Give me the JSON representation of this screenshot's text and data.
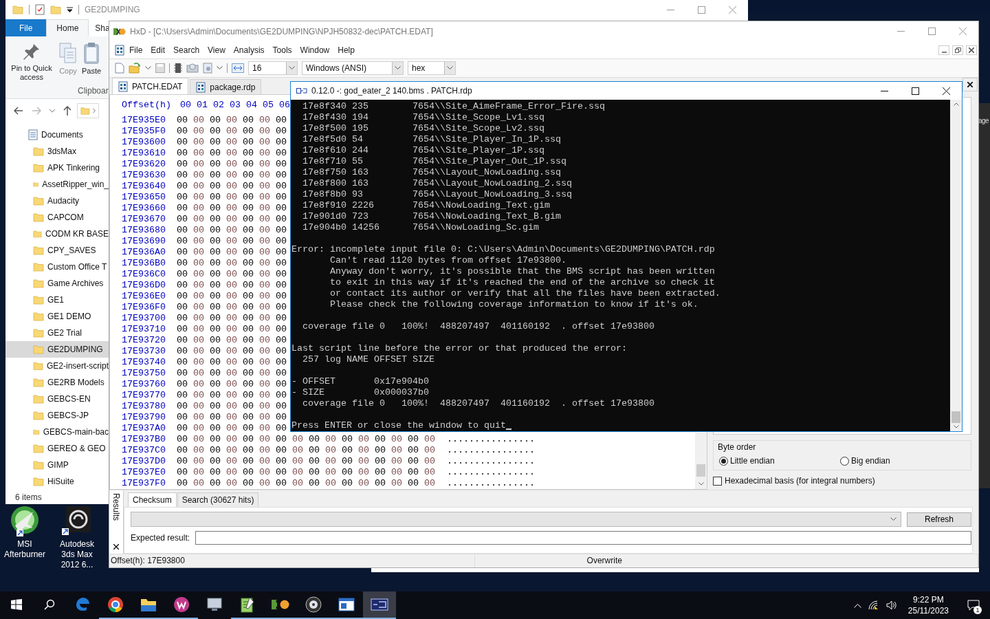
{
  "explorer": {
    "title": "GE2DUMPING",
    "ribbon_tabs": [
      {
        "label": "File",
        "kind": "file",
        "selected": false
      },
      {
        "label": "Home",
        "kind": "tab",
        "selected": true
      },
      {
        "label": "Sha",
        "kind": "tab",
        "selected": false
      }
    ],
    "ribbon_buttons": [
      {
        "label": "Pin to Quick access",
        "kind": "pin",
        "disabled": false
      },
      {
        "label": "Copy",
        "kind": "copy",
        "disabled": true
      },
      {
        "label": "Paste",
        "kind": "paste",
        "disabled": false
      }
    ],
    "ribbon_group": "Clipboar",
    "tree": [
      {
        "label": "Documents",
        "selected": false,
        "children": [
          {
            "label": "3dsMax",
            "selected": false
          },
          {
            "label": "APK Tinkering",
            "selected": false
          },
          {
            "label": "AssetRipper_win_",
            "selected": false
          },
          {
            "label": "Audacity",
            "selected": false
          },
          {
            "label": "CAPCOM",
            "selected": false
          },
          {
            "label": "CODM KR BASE",
            "selected": false
          },
          {
            "label": "CPY_SAVES",
            "selected": false
          },
          {
            "label": "Custom Office T",
            "selected": false
          },
          {
            "label": "Game Archives",
            "selected": false
          },
          {
            "label": "GE1",
            "selected": false
          },
          {
            "label": "GE1 DEMO",
            "selected": false
          },
          {
            "label": "GE2 Trial",
            "selected": false
          },
          {
            "label": "GE2DUMPING",
            "selected": true
          },
          {
            "label": "GE2-insert-script",
            "selected": false
          },
          {
            "label": "GE2RB Models",
            "selected": false
          },
          {
            "label": "GEBCS-EN",
            "selected": false
          },
          {
            "label": "GEBCS-JP",
            "selected": false
          },
          {
            "label": "GEBCS-main-bac",
            "selected": false
          },
          {
            "label": "GEREO & GEO",
            "selected": false
          },
          {
            "label": "GIMP",
            "selected": false
          },
          {
            "label": "HiSuite",
            "selected": false
          }
        ]
      }
    ],
    "status": "6 items"
  },
  "desktop_icons": [
    {
      "label": "MSI Afterburner",
      "kind": "afterburner"
    },
    {
      "label": "Autodesk 3ds Max 2012 6...",
      "kind": "max"
    }
  ],
  "background_window": {
    "fragment": "age"
  },
  "hxd": {
    "title": "HxD - [C:\\Users\\Admin\\Documents\\GE2DUMPING\\NPJH50832-dec\\PATCH.EDAT]",
    "menu": [
      "File",
      "Edit",
      "Search",
      "View",
      "Analysis",
      "Tools",
      "Window",
      "Help"
    ],
    "toolbar": {
      "bytes_per_row": "16",
      "charset": "Windows (ANSI)",
      "offset_base": "hex"
    },
    "tabs": [
      {
        "label": "PATCH.EDAT",
        "selected": true
      },
      {
        "label": "package.rdp",
        "selected": false
      }
    ],
    "hex": {
      "header": "Offset(h)",
      "columns": [
        "00",
        "01",
        "02",
        "03",
        "04",
        "05",
        "06"
      ],
      "rows": [
        {
          "offset": "17E935E0",
          "bytes": "00 00 00 00 00 00 00"
        },
        {
          "offset": "17E935F0",
          "bytes": "00 00 00 00 00 00 00"
        },
        {
          "offset": "17E93600",
          "bytes": "00 00 00 00 00 00 00"
        },
        {
          "offset": "17E93610",
          "bytes": "00 00 00 00 00 00 00"
        },
        {
          "offset": "17E93620",
          "bytes": "00 00 00 00 00 00 00"
        },
        {
          "offset": "17E93630",
          "bytes": "00 00 00 00 00 00 00"
        },
        {
          "offset": "17E93640",
          "bytes": "00 00 00 00 00 00 00"
        },
        {
          "offset": "17E93650",
          "bytes": "00 00 00 00 00 00 00"
        },
        {
          "offset": "17E93660",
          "bytes": "00 00 00 00 00 00 00"
        },
        {
          "offset": "17E93670",
          "bytes": "00 00 00 00 00 00 00"
        },
        {
          "offset": "17E93680",
          "bytes": "00 00 00 00 00 00 00"
        },
        {
          "offset": "17E93690",
          "bytes": "00 00 00 00 00 00 00"
        },
        {
          "offset": "17E936A0",
          "bytes": "00 00 00 00 00 00 00"
        },
        {
          "offset": "17E936B0",
          "bytes": "00 00 00 00 00 00 00"
        },
        {
          "offset": "17E936C0",
          "bytes": "00 00 00 00 00 00 00"
        },
        {
          "offset": "17E936D0",
          "bytes": "00 00 00 00 00 00 00"
        },
        {
          "offset": "17E936E0",
          "bytes": "00 00 00 00 00 00 00"
        },
        {
          "offset": "17E936F0",
          "bytes": "00 00 00 00 00 00 00"
        },
        {
          "offset": "17E93700",
          "bytes": "00 00 00 00 00 00 00"
        },
        {
          "offset": "17E93710",
          "bytes": "00 00 00 00 00 00 00"
        },
        {
          "offset": "17E93720",
          "bytes": "00 00 00 00 00 00 00"
        },
        {
          "offset": "17E93730",
          "bytes": "00 00 00 00 00 00 00"
        },
        {
          "offset": "17E93740",
          "bytes": "00 00 00 00 00 00 00"
        },
        {
          "offset": "17E93750",
          "bytes": "00 00 00 00 00 00 00"
        },
        {
          "offset": "17E93760",
          "bytes": "00 00 00 00 00 00 00"
        },
        {
          "offset": "17E93770",
          "bytes": "00 00 00 00 00 00 00"
        },
        {
          "offset": "17E93780",
          "bytes": "00 00 00 00 00 00 00"
        },
        {
          "offset": "17E93790",
          "bytes": "00 00 00 00 00 00 00"
        },
        {
          "offset": "17E937A0",
          "bytes": "00 00 00 00 00 00 00"
        },
        {
          "offset": "17E937B0",
          "bytes": "00 00 00 00 00 00 00 00 00 00 00 00 00 00 00 00",
          "text": "................"
        },
        {
          "offset": "17E937C0",
          "bytes": "00 00 00 00 00 00 00 00 00 00 00 00 00 00 00 00",
          "text": "................"
        },
        {
          "offset": "17E937D0",
          "bytes": "00 00 00 00 00 00 00 00 00 00 00 00 00 00 00 00",
          "text": "................"
        },
        {
          "offset": "17E937E0",
          "bytes": "00 00 00 00 00 00 00 00 00 00 00 00 00 00 00 00",
          "text": "................"
        },
        {
          "offset": "17E937F0",
          "bytes": "00 00 00 00 00 00 00 00 00 00 00 00 00 00 00 00",
          "text": "................"
        }
      ]
    },
    "inspector": {
      "byte_order_label": "Byte order",
      "byte_order": [
        {
          "label": "Little endian",
          "selected": true
        },
        {
          "label": "Big endian",
          "selected": false
        }
      ],
      "hex_basis": {
        "label": "Hexadecimal basis (for integral numbers)",
        "checked": false
      }
    },
    "results": {
      "side_label": "Results",
      "tabs": [
        {
          "label": "Checksum",
          "selected": true
        },
        {
          "label": "Search (30627 hits)",
          "selected": false
        }
      ],
      "refresh": "Refresh",
      "expected_label": "Expected result:"
    },
    "status_bar": [
      "Offset(h): 17E93800",
      "Overwrite"
    ]
  },
  "console": {
    "title": "0.12.0 -: god_eater_2 140.bms . PATCH.rdp",
    "blocks": [
      [
        "  17e8f340 235        7654\\\\Site_AimeFrame_Error_Fire.ssq",
        "  17e8f430 194        7654\\\\Site_Scope_Lv1.ssq",
        "  17e8f500 195        7654\\\\Site_Scope_Lv2.ssq",
        "  17e8f5d0 54         7654\\\\Site_Player_In_1P.ssq",
        "  17e8f610 244        7654\\\\Site_Player_1P.ssq",
        "  17e8f710 55         7654\\\\Site_Player_Out_1P.ssq",
        "  17e8f750 163        7654\\\\Layout_NowLoading.ssq",
        "  17e8f800 163        7654\\\\Layout_NowLoading_2.ssq",
        "  17e8f8b0 93         7654\\\\Layout_NowLoading_3.ssq",
        "  17e8f910 2226       7654\\\\NowLoading_Text.gim",
        "  17e901d0 723        7654\\\\NowLoading_Text_B.gim",
        "  17e904b0 14256      7654\\\\NowLoading_Sc.gim"
      ],
      [
        "Error: incomplete input file 0: C:\\Users\\Admin\\Documents\\GE2DUMPING\\PATCH.rdp",
        "       Can't read 1120 bytes from offset 17e93800.",
        "       Anyway don't worry, it's possible that the BMS script has been written",
        "       to exit in this way if it's reached the end of the archive so check it",
        "       or contact its author or verify that all the files have been extracted.",
        "       Please check the following coverage information to know if it's ok."
      ],
      [
        "  coverage file 0   100%!  488207497  401160192  . offset 17e93800"
      ],
      [
        "Last script line before the error or that produced the error:",
        "  257 log NAME OFFSET SIZE"
      ],
      [
        "- OFFSET       0x17e904b0",
        "- SIZE         0x000037b0",
        "  coverage file 0   100%!  488207497  401160192  . offset 17e93800"
      ],
      [
        "Press ENTER or close the window to quit"
      ]
    ]
  },
  "taskbar": {
    "apps": [
      {
        "kind": "edge",
        "running": false,
        "selected": false
      },
      {
        "kind": "chrome",
        "running": true,
        "selected": false
      },
      {
        "kind": "files",
        "running": true,
        "selected": false
      },
      {
        "kind": "wps",
        "running": true,
        "selected": false
      },
      {
        "kind": "monitor",
        "running": false,
        "selected": false
      },
      {
        "kind": "notepad",
        "running": true,
        "selected": false
      },
      {
        "kind": "hxd",
        "running": true,
        "selected": false
      },
      {
        "kind": "disc",
        "running": true,
        "selected": false
      },
      {
        "kind": "window",
        "running": true,
        "selected": false
      },
      {
        "kind": "console",
        "running": true,
        "selected": true
      }
    ],
    "time": "9:22 PM",
    "date": "25/11/2023",
    "notifications": "1"
  }
}
